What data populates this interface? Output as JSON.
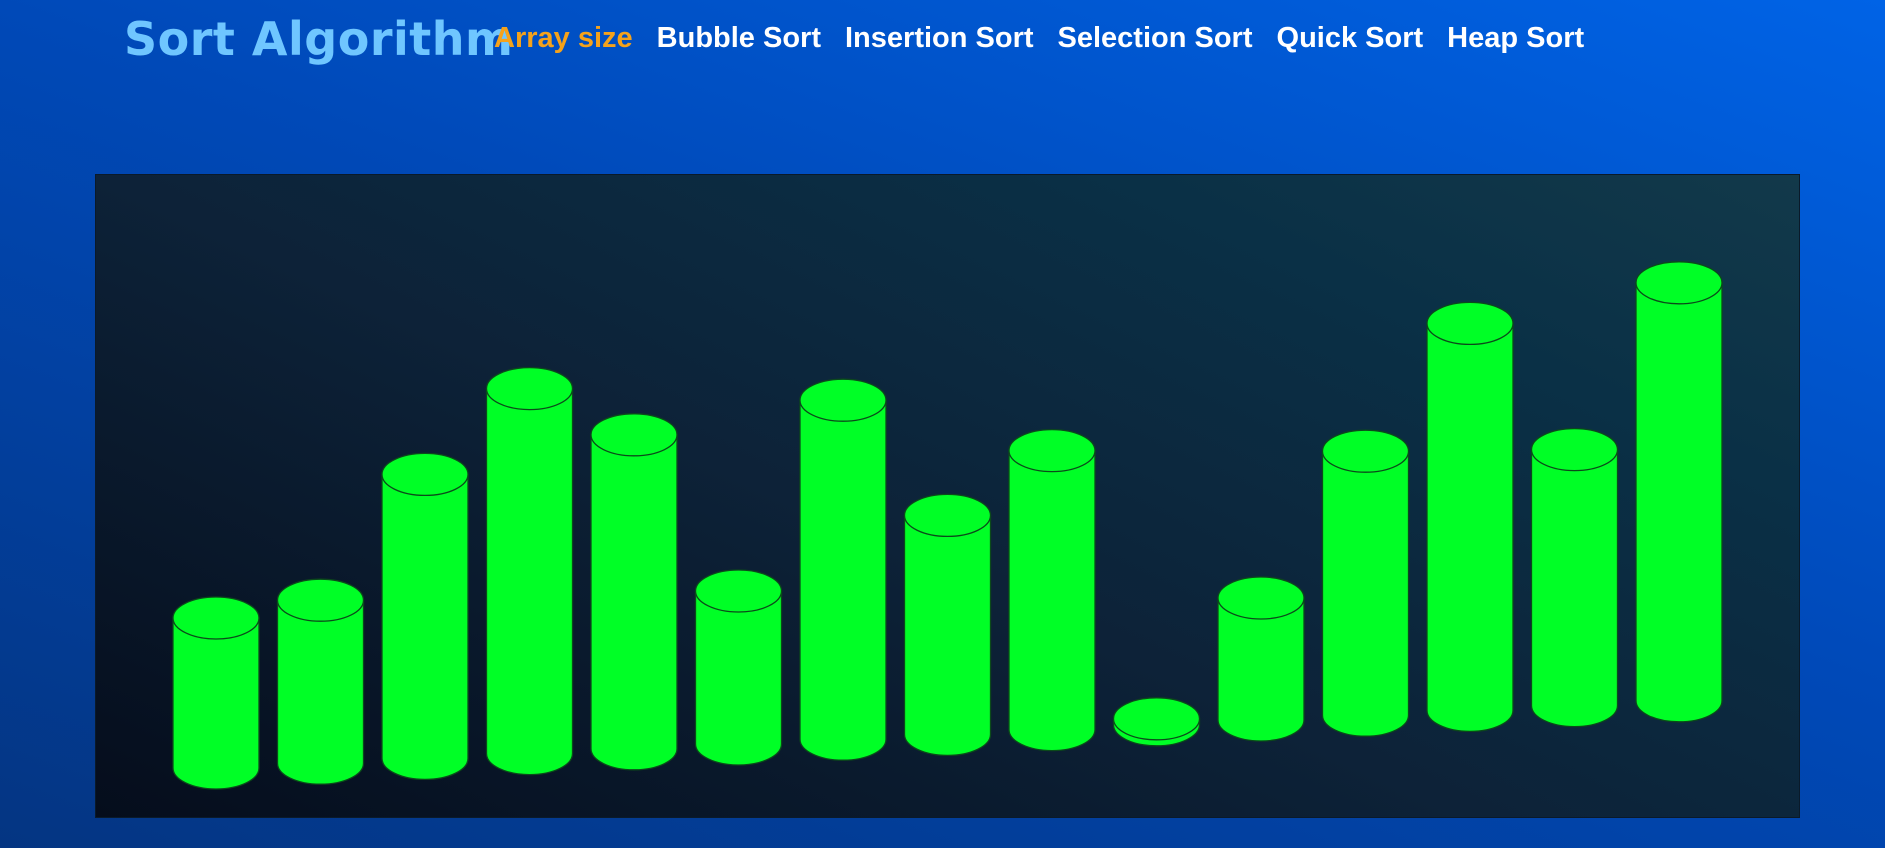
{
  "app": {
    "title": "Sort Algorithm"
  },
  "nav": {
    "array_size": "Array size",
    "bubble_sort": "Bubble Sort",
    "insertion_sort": "Insertion Sort",
    "selection_sort": "Selection Sort",
    "quick_sort": "Quick Sort",
    "heap_sort": "Heap Sort"
  },
  "colors": {
    "title": "#6fc6ff",
    "accent_nav": "#f5a21b",
    "nav": "#ffffff",
    "bar_fill": "#00ff26",
    "bar_stroke": "#0b4a1a"
  },
  "array": {
    "values": [
      150,
      163,
      284,
      365,
      314,
      153,
      339,
      219,
      279,
      6,
      122,
      264,
      387,
      256,
      418
    ]
  }
}
